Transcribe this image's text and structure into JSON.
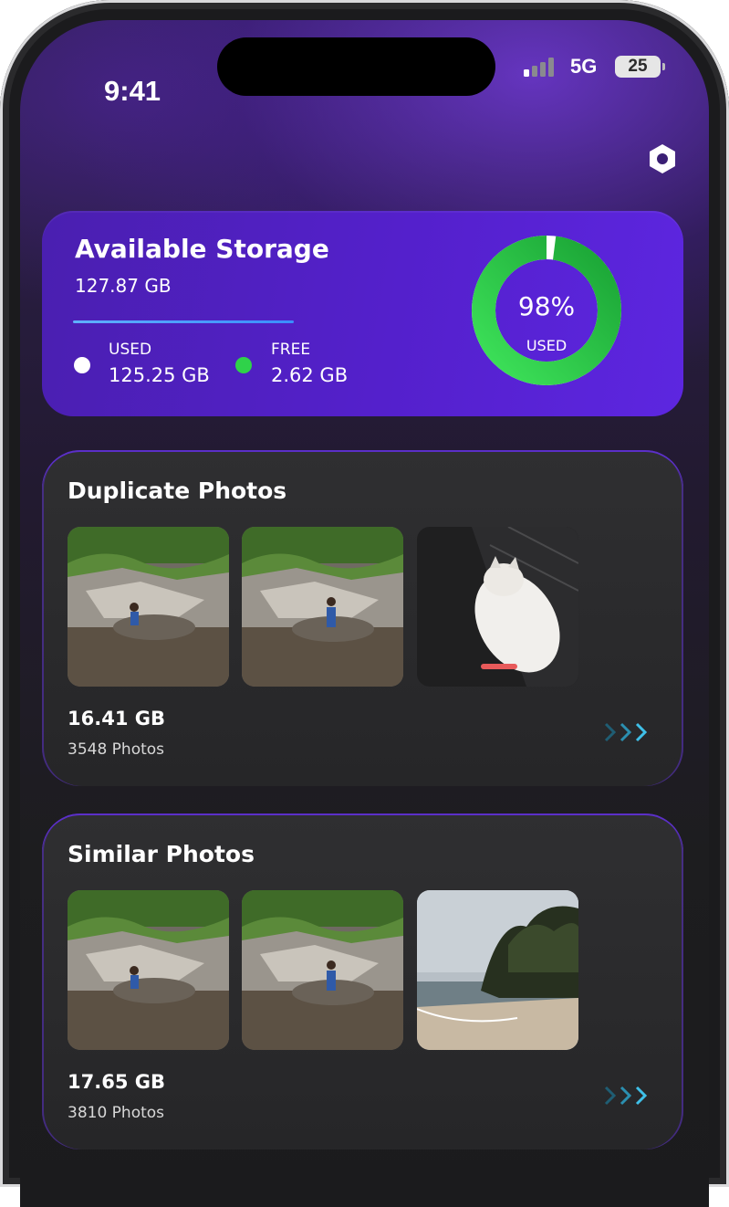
{
  "status_bar": {
    "time": "9:41",
    "network": "5G",
    "battery": "25"
  },
  "header": {
    "settings_icon": "hexagon-gear-icon"
  },
  "storage": {
    "title": "Available Storage",
    "total": "127.87 GB",
    "used_label": "USED",
    "used_value": "125.25 GB",
    "free_label": "FREE",
    "free_value": "2.62 GB",
    "percent": "98%",
    "percent_label": "USED",
    "used_fraction": 0.98,
    "colors": {
      "used": "#ffffff",
      "free": "#2fd24a",
      "ring": "#22c03a"
    }
  },
  "categories": [
    {
      "title": "Duplicate Photos",
      "size": "16.41 GB",
      "count": "3548 Photos",
      "thumbnails": [
        "waterfall-girl-photo",
        "waterfall-girl-photo",
        "white-cat-photo"
      ]
    },
    {
      "title": "Similar Photos",
      "size": "17.65 GB",
      "count": "3810 Photos",
      "thumbnails": [
        "waterfall-girl-photo",
        "waterfall-girl-photo",
        "beach-photo"
      ]
    }
  ]
}
